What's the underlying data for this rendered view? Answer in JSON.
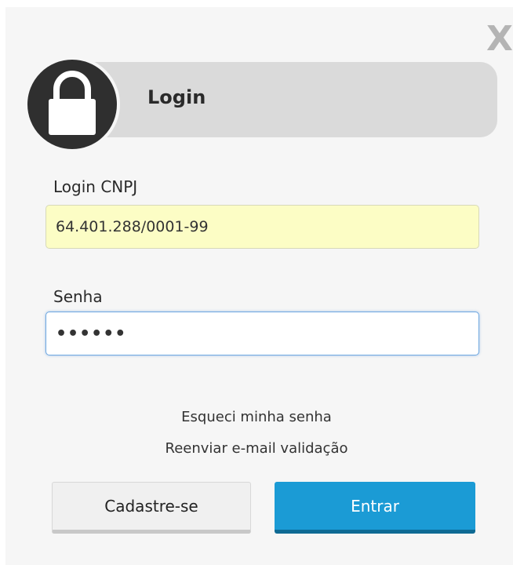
{
  "dialog": {
    "close_label": "X",
    "title": "Login",
    "icon": "lock-icon"
  },
  "form": {
    "cnpj_label": "Login CNPJ",
    "cnpj_value": "64.401.288/0001-99",
    "senha_label": "Senha",
    "senha_value": "••••••"
  },
  "links": {
    "forgot": "Esqueci minha senha",
    "resend": "Reenviar e-mail validação"
  },
  "buttons": {
    "register": "Cadastre-se",
    "enter": "Entrar"
  },
  "colors": {
    "primary": "#1b9bd5",
    "autofill": "#fcfdc5"
  }
}
